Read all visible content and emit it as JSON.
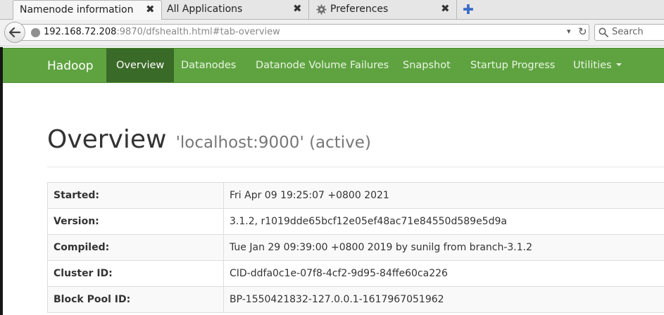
{
  "browser": {
    "tabs": [
      {
        "title": "Namenode information",
        "close": "✖"
      },
      {
        "title": "All Applications",
        "close": "✖"
      },
      {
        "title": "Preferences",
        "close": "✖",
        "icon": "gear-icon"
      }
    ],
    "new_tab": "✚",
    "back": "🡐",
    "url_host": "192.168.72.208",
    "url_rest": ":9870/dfshealth.html#tab-overview",
    "url_dropdown": "▾",
    "reload": "↻",
    "search_placeholder": "Search"
  },
  "header": {
    "brand": "Hadoop",
    "items": [
      {
        "label": "Overview"
      },
      {
        "label": "Datanodes"
      },
      {
        "label": "Datanode Volume Failures"
      },
      {
        "label": "Snapshot"
      },
      {
        "label": "Startup Progress"
      },
      {
        "label": "Utilities"
      }
    ],
    "colors": {
      "bar": "#5fa341",
      "active": "#3a6a28"
    }
  },
  "page": {
    "title": "Overview",
    "subtitle": "'localhost:9000' (active)"
  },
  "info_table": [
    {
      "key": "Started:",
      "value": "Fri Apr 09 19:25:07 +0800 2021"
    },
    {
      "key": "Version:",
      "value": "3.1.2, r1019dde65bcf12e05ef48ac71e84550d589e5d9a"
    },
    {
      "key": "Compiled:",
      "value": "Tue Jan 29 09:39:00 +0800 2019 by sunilg from branch-3.1.2"
    },
    {
      "key": "Cluster ID:",
      "value": "CID-ddfa0c1e-07f8-4cf2-9d95-84ffe60ca226"
    },
    {
      "key": "Block Pool ID:",
      "value": "BP-1550421832-127.0.0.1-1617967051962"
    }
  ]
}
